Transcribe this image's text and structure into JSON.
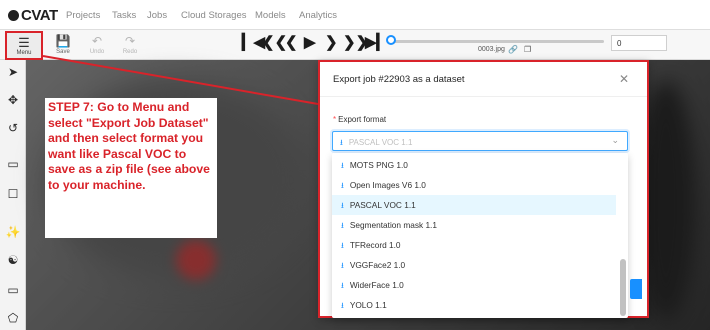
{
  "app": {
    "logo": "CVAT"
  },
  "nav": {
    "items": [
      {
        "label": "Projects"
      },
      {
        "label": "Tasks"
      },
      {
        "label": "Jobs"
      },
      {
        "label": "Cloud Storages"
      },
      {
        "label": "Models"
      },
      {
        "label": "Analytics"
      }
    ]
  },
  "toolbar": {
    "menu_label": "Menu",
    "save_label": "Save",
    "undo_label": "Undo",
    "redo_label": "Redo",
    "filename": "0003.jpg",
    "frame_value": "0"
  },
  "annotation": {
    "text": "STEP 7: Go to Menu and select \"Export Job Dataset\" and then select format you want like Pascal VOC to save as a zip file (see above to your machine."
  },
  "dialog": {
    "title": "Export job #22903 as a dataset",
    "format_label": "Export format",
    "format_value": "PASCAL VOC 1.1",
    "options": [
      {
        "label": "MOTS PNG 1.0",
        "selected": false
      },
      {
        "label": "Open Images V6 1.0",
        "selected": false
      },
      {
        "label": "PASCAL VOC 1.1",
        "selected": true
      },
      {
        "label": "Segmentation mask 1.1",
        "selected": false
      },
      {
        "label": "TFRecord 1.0",
        "selected": false
      },
      {
        "label": "VGGFace2 1.0",
        "selected": false
      },
      {
        "label": "WiderFace 1.0",
        "selected": false
      },
      {
        "label": "YOLO 1.1",
        "selected": false
      }
    ]
  },
  "colors": {
    "accent": "#1890ff",
    "highlight_red": "#d9232a"
  }
}
